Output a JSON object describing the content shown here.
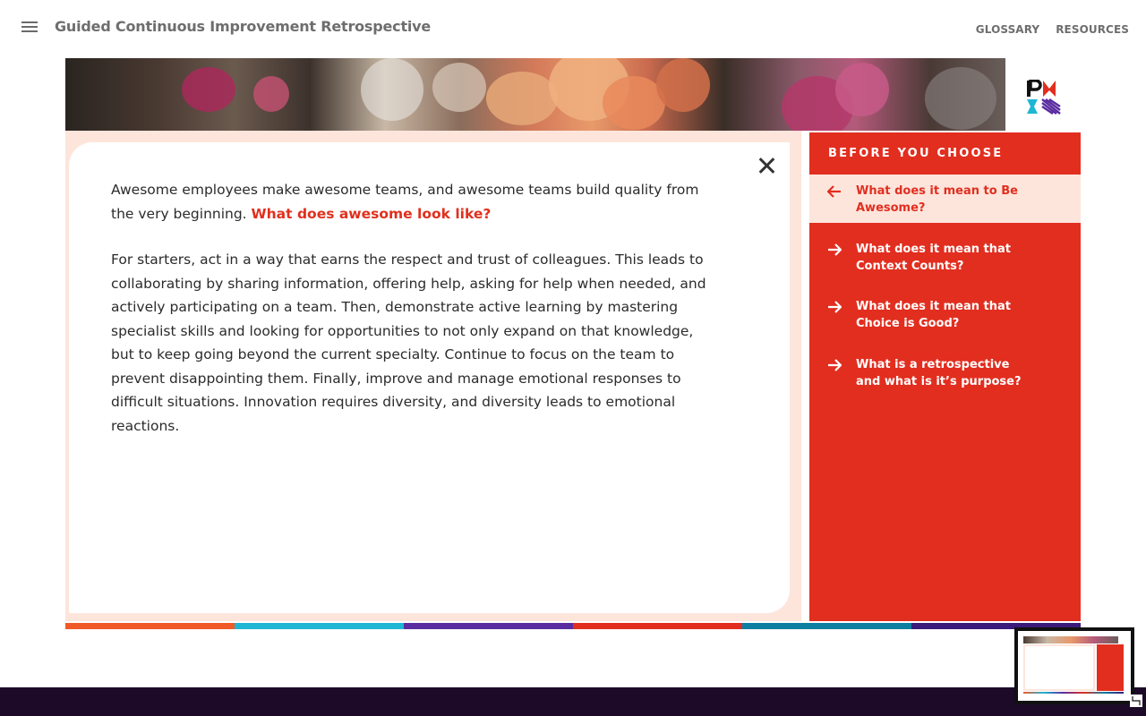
{
  "header": {
    "app_title": "Guided Continuous Improvement Retrospective",
    "links": [
      "GLOSSARY",
      "RESOURCES"
    ]
  },
  "content": {
    "intro_text": "Awesome employees make awesome teams, and awesome teams build quality from the very beginning.",
    "intro_highlight": "What does awesome look like?",
    "body_text": "For starters, act in a way that earns the respect and trust of colleagues. This leads to collaborating by sharing information, offering help, asking for help when needed, and actively participating on a team. Then, demonstrate active learning by mastering specialist skills and looking for opportunities to not only expand on that knowledge, but to keep going beyond the current specialty. Continue to focus on the team to prevent disappointing them. Finally, improve and manage emotional responses to difficult situations. Innovation requires diversity, and diversity leads to emotional reactions."
  },
  "sidebar": {
    "title": "BEFORE YOU CHOOSE",
    "items": [
      {
        "label": "What does it mean to Be Awesome?",
        "active": true,
        "icon": "arrow-left-icon"
      },
      {
        "label": "What does it mean that Context Counts?",
        "active": false,
        "icon": "arrow-right-icon"
      },
      {
        "label": "What does it mean that Choice is Good?",
        "active": false,
        "icon": "arrow-right-icon"
      },
      {
        "label": "What is a retrospective and what is it’s purpose?",
        "active": false,
        "icon": "arrow-right-icon"
      }
    ]
  },
  "colors": {
    "accent": "#e22e1f",
    "panel_tint": "#fde5dc",
    "footer": "#1c0a28",
    "stripes": [
      "#f05a28",
      "#1fb6d4",
      "#5a2ca0",
      "#e22e1f",
      "#0e7fa0",
      "#3a1a7a"
    ]
  }
}
